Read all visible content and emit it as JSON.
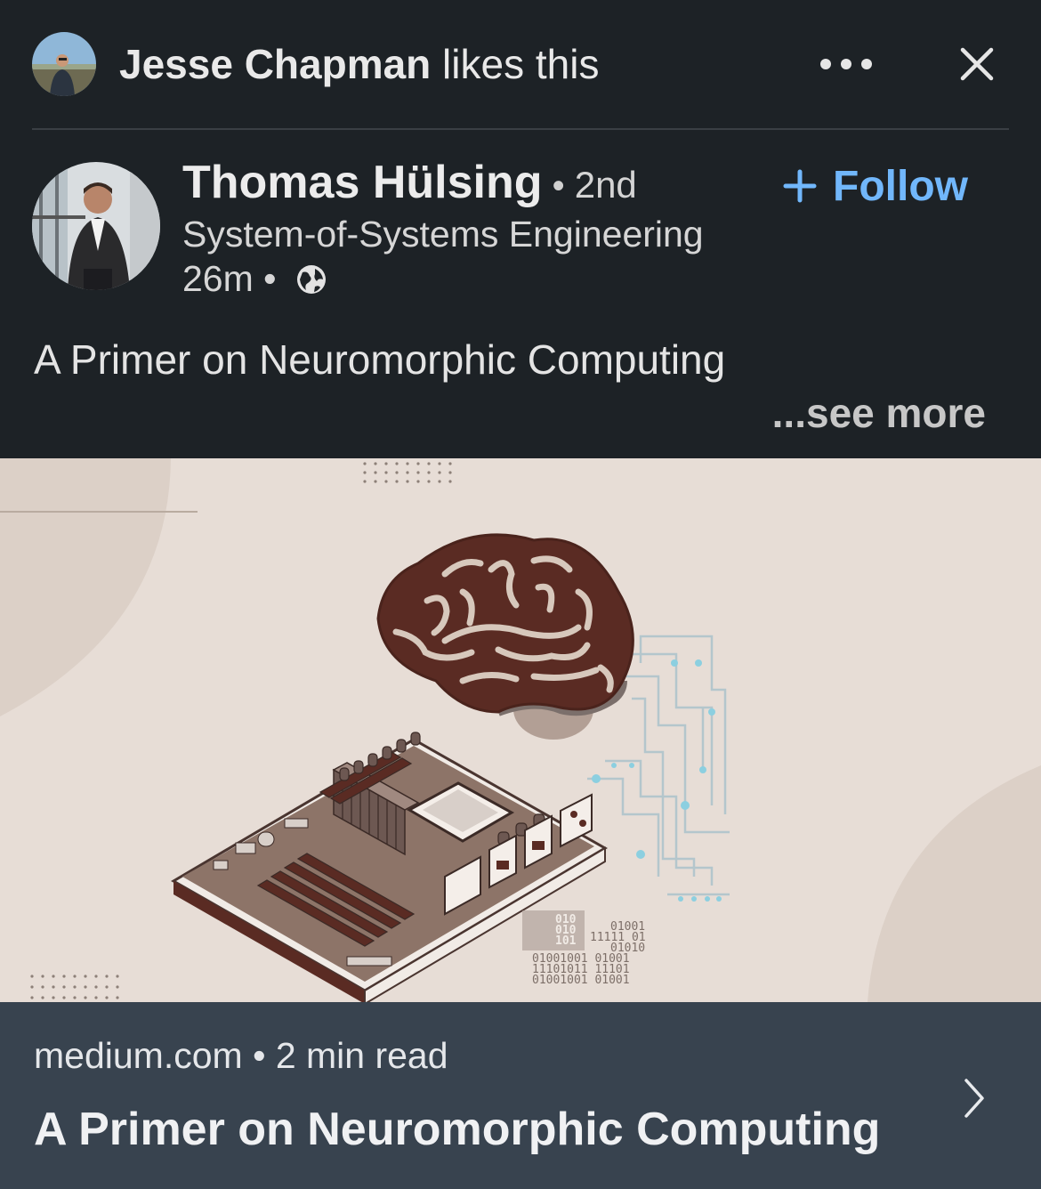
{
  "social": {
    "actor_name": "Jesse Chapman",
    "action_text": " likes this",
    "more_icon": "ellipsis-icon",
    "close_icon": "close-icon"
  },
  "author": {
    "name": "Thomas Hülsing",
    "separator": " • ",
    "degree": "2nd",
    "headline": "System-of-Systems Engineering",
    "time": "26m",
    "meta_separator": " • ",
    "visibility_icon": "globe-icon"
  },
  "follow": {
    "label": "Follow",
    "icon": "plus-icon"
  },
  "post": {
    "text": "A Primer on Neuromorphic Computing",
    "see_more": "...see more"
  },
  "article_image": {
    "chip_bits": [
      "010",
      "010",
      "101"
    ],
    "binary_rows": [
      "01001",
      "11111 01",
      "01010",
      "01001001 01001",
      "11101011 11101",
      "01001001 01001"
    ]
  },
  "link_preview": {
    "source": "medium.com",
    "separator": " • ",
    "read_time": "2 min read",
    "title": "A Primer on Neuromorphic Computing",
    "chevron_icon": "chevron-right-icon"
  },
  "colors": {
    "background": "#1d2226",
    "accent": "#71b7fb",
    "footer": "#38434f",
    "image_bg": "#e7ddd6",
    "brain": "#5a2b23"
  }
}
